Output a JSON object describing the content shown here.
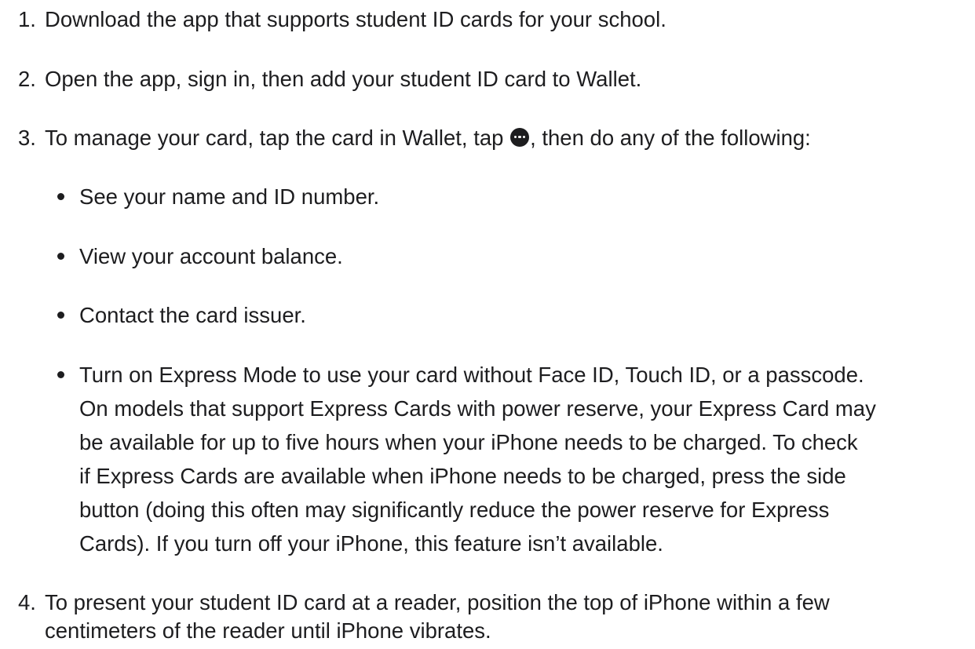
{
  "steps": [
    {
      "number": "1.",
      "text": "Download the app that supports student ID cards for your school."
    },
    {
      "number": "2.",
      "text": "Open the app, sign in, then add your student ID card to Wallet."
    },
    {
      "number": "3.",
      "text_before_icon": "To manage your card, tap the card in Wallet, tap",
      "icon": "more-icon",
      "text_after_icon": ", then do any of the following:",
      "bullets": [
        {
          "lines": [
            "See your name and ID number."
          ]
        },
        {
          "lines": [
            "View your account balance."
          ]
        },
        {
          "lines": [
            "Contact the card issuer."
          ]
        },
        {
          "lines": [
            "Turn on Express Mode to use your card without Face ID, Touch ID, or a passcode.",
            "On models that support Express Cards with power reserve, your Express Card may",
            "be available for up to five hours when your iPhone needs to be charged. To check",
            "if Express Cards are available when iPhone needs to be charged, press the side",
            "button (doing this often may significantly reduce the power reserve for Express",
            "Cards). If you turn off your iPhone, this feature isn’t available."
          ]
        }
      ]
    },
    {
      "number": "4.",
      "lines": [
        "To present your student ID card at a reader, position the top of iPhone within a few",
        "centimeters of the reader until iPhone vibrates."
      ]
    }
  ]
}
